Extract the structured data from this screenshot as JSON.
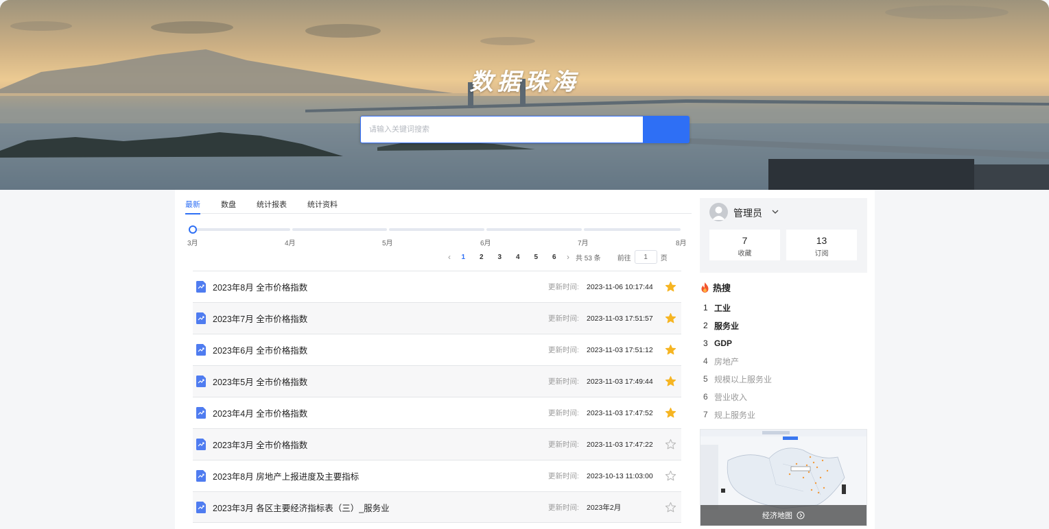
{
  "hero": {
    "title": "数据珠海",
    "search": {
      "placeholder": "请输入关键词搜索",
      "value": ""
    }
  },
  "tabs": [
    {
      "label": "最新",
      "active": true
    },
    {
      "label": "数盘",
      "active": false
    },
    {
      "label": "统计报表",
      "active": false
    },
    {
      "label": "统计资料",
      "active": false
    }
  ],
  "timeline": {
    "labels": [
      "3月",
      "4月",
      "5月",
      "6月",
      "7月",
      "8月"
    ],
    "selected": "3月"
  },
  "pagination": {
    "prev_icon": "chevron-left-icon",
    "pages": [
      "1",
      "2",
      "3",
      "4",
      "5",
      "6"
    ],
    "current": "1",
    "next_icon": "chevron-right-icon",
    "total_text": "共 53 条",
    "goto_label": "前往",
    "goto_value": "1",
    "page_suffix": "页"
  },
  "list": {
    "meta_label": "更新时间:",
    "rows": [
      {
        "title": "2023年8月 全市价格指数",
        "time": "2023-11-06 10:17:44",
        "starred": true
      },
      {
        "title": "2023年7月 全市价格指数",
        "time": "2023-11-03 17:51:57",
        "starred": true
      },
      {
        "title": "2023年6月 全市价格指数",
        "time": "2023-11-03 17:51:12",
        "starred": true
      },
      {
        "title": "2023年5月 全市价格指数",
        "time": "2023-11-03 17:49:44",
        "starred": true
      },
      {
        "title": "2023年4月 全市价格指数",
        "time": "2023-11-03 17:47:52",
        "starred": true
      },
      {
        "title": "2023年3月 全市价格指数",
        "time": "2023-11-03 17:47:22",
        "starred": false
      },
      {
        "title": "2023年8月 房地产上报进度及主要指标",
        "time": "2023-10-13 11:03:00",
        "starred": false
      },
      {
        "title": "2023年3月 各区主要经济指标表（三）_服务业",
        "time": "2023年2月",
        "starred": false
      }
    ]
  },
  "profile": {
    "name": "管理员",
    "favorites": {
      "value": "7",
      "label": "收藏"
    },
    "subscriptions": {
      "value": "13",
      "label": "订阅"
    }
  },
  "hot": {
    "title": "热搜",
    "items": [
      {
        "rank": "1",
        "text": "工业"
      },
      {
        "rank": "2",
        "text": "服务业"
      },
      {
        "rank": "3",
        "text": "GDP"
      },
      {
        "rank": "4",
        "text": "房地产"
      },
      {
        "rank": "5",
        "text": "规模以上服务业"
      },
      {
        "rank": "6",
        "text": "营业收入"
      },
      {
        "rank": "7",
        "text": "规上服务业"
      }
    ]
  },
  "map_card": {
    "caption": "经济地图"
  },
  "colors": {
    "accent": "#2e6ff5",
    "star_active": "#f6b522",
    "star_inactive": "#b8b8b8",
    "doc_icon": "#4f7cf0"
  }
}
